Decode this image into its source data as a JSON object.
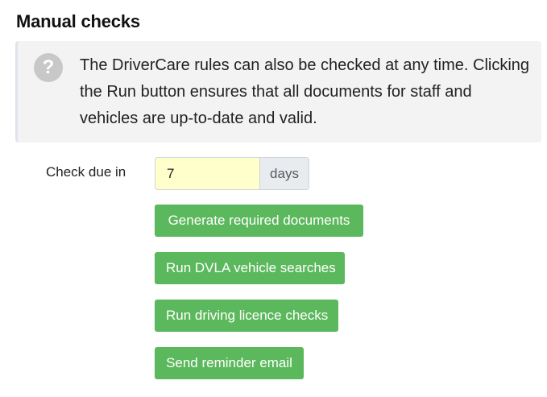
{
  "section": {
    "title": "Manual checks"
  },
  "info": {
    "icon": "question-circle-icon",
    "text": "The DriverCare rules can also be checked at any time. Clicking the Run button ensures that all documents for staff and vehicles are up-to-date and valid."
  },
  "check_due": {
    "label": "Check due in",
    "value": "7",
    "unit": "days"
  },
  "actions": {
    "generate_documents": "Generate required documents",
    "dvla_vehicle_searches": "Run DVLA vehicle searches",
    "driving_licence_checks": "Run driving licence checks",
    "reminder_email": "Send reminder email"
  },
  "colors": {
    "button_green": "#5cb85c",
    "input_highlight": "#ffffcc",
    "info_background": "#f3f3f4"
  }
}
